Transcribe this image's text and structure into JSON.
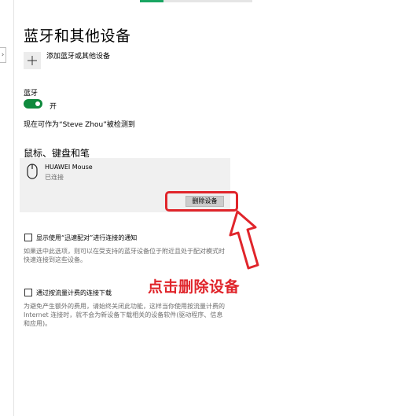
{
  "page": {
    "title": "蓝牙和其他设备",
    "add_device_label": "添加蓝牙或其他设备",
    "rail_expander_glyph": "›"
  },
  "bluetooth": {
    "label": "蓝牙",
    "toggle_state": "开",
    "on": true,
    "discoverable_text": "现在可作为“Steve Zhou”被检测到"
  },
  "devices_section": {
    "title": "鼠标、键盘和笔",
    "device": {
      "name": "HUAWEI  Mouse",
      "status": "已连接",
      "icon": "mouse-icon",
      "remove_label": "删除设备"
    }
  },
  "options": {
    "swift_pair": {
      "label": "显示使用“迅速配对”进行连接的通知",
      "checked": false,
      "description": [
        "如果选中此选项，则可以在受支持的蓝牙设备位于附近且处于配对模式时",
        "快速连接到这些设备。"
      ]
    },
    "metered": {
      "label": "通过按流量计费的连接下载",
      "checked": false,
      "description": [
        "为避免产生额外的费用，请始终关闭此功能，这样当你使用按流量计费的",
        "Internet 连接时，就不会为新设备下载相关的设备软件(驱动程序、信息",
        "和应用)。"
      ]
    }
  },
  "annotation": {
    "text": "点击删除设备"
  },
  "colors": {
    "toggle_on": "#0f8a3d",
    "annotation_red": "#e0252b",
    "card_bg": "#f0f0f0"
  }
}
